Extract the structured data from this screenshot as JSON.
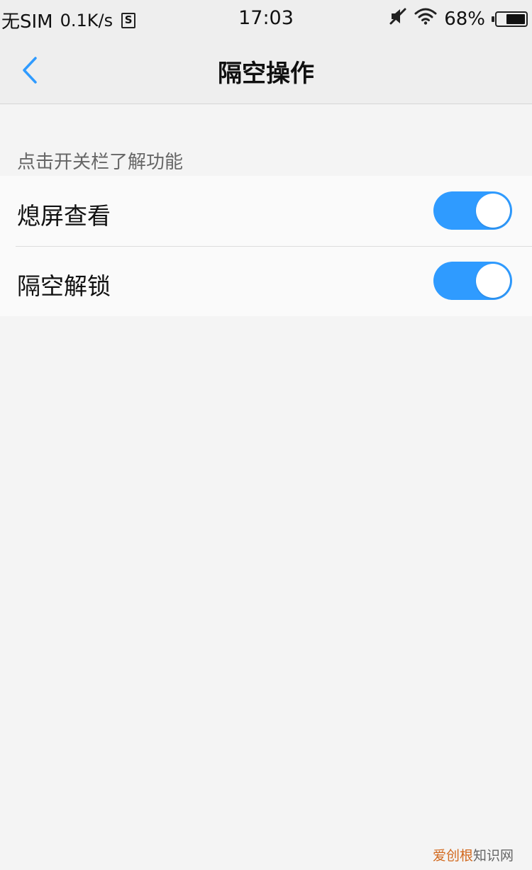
{
  "status_bar": {
    "carrier": "无SIM",
    "speed": "0.1K/s",
    "notif_icon_letter": "S",
    "time": "17:03",
    "battery_percent": "68%",
    "battery_level": 0.68
  },
  "nav": {
    "title": "隔空操作"
  },
  "section": {
    "hint": "点击开关栏了解功能"
  },
  "settings": [
    {
      "label": "熄屏查看",
      "enabled": true
    },
    {
      "label": "隔空解锁",
      "enabled": true
    }
  ],
  "watermark": {
    "brand": "爱创根",
    "suffix": "知识网"
  },
  "colors": {
    "accent": "#2f9bff",
    "background": "#f4f4f4",
    "bar": "#eeeeee"
  }
}
